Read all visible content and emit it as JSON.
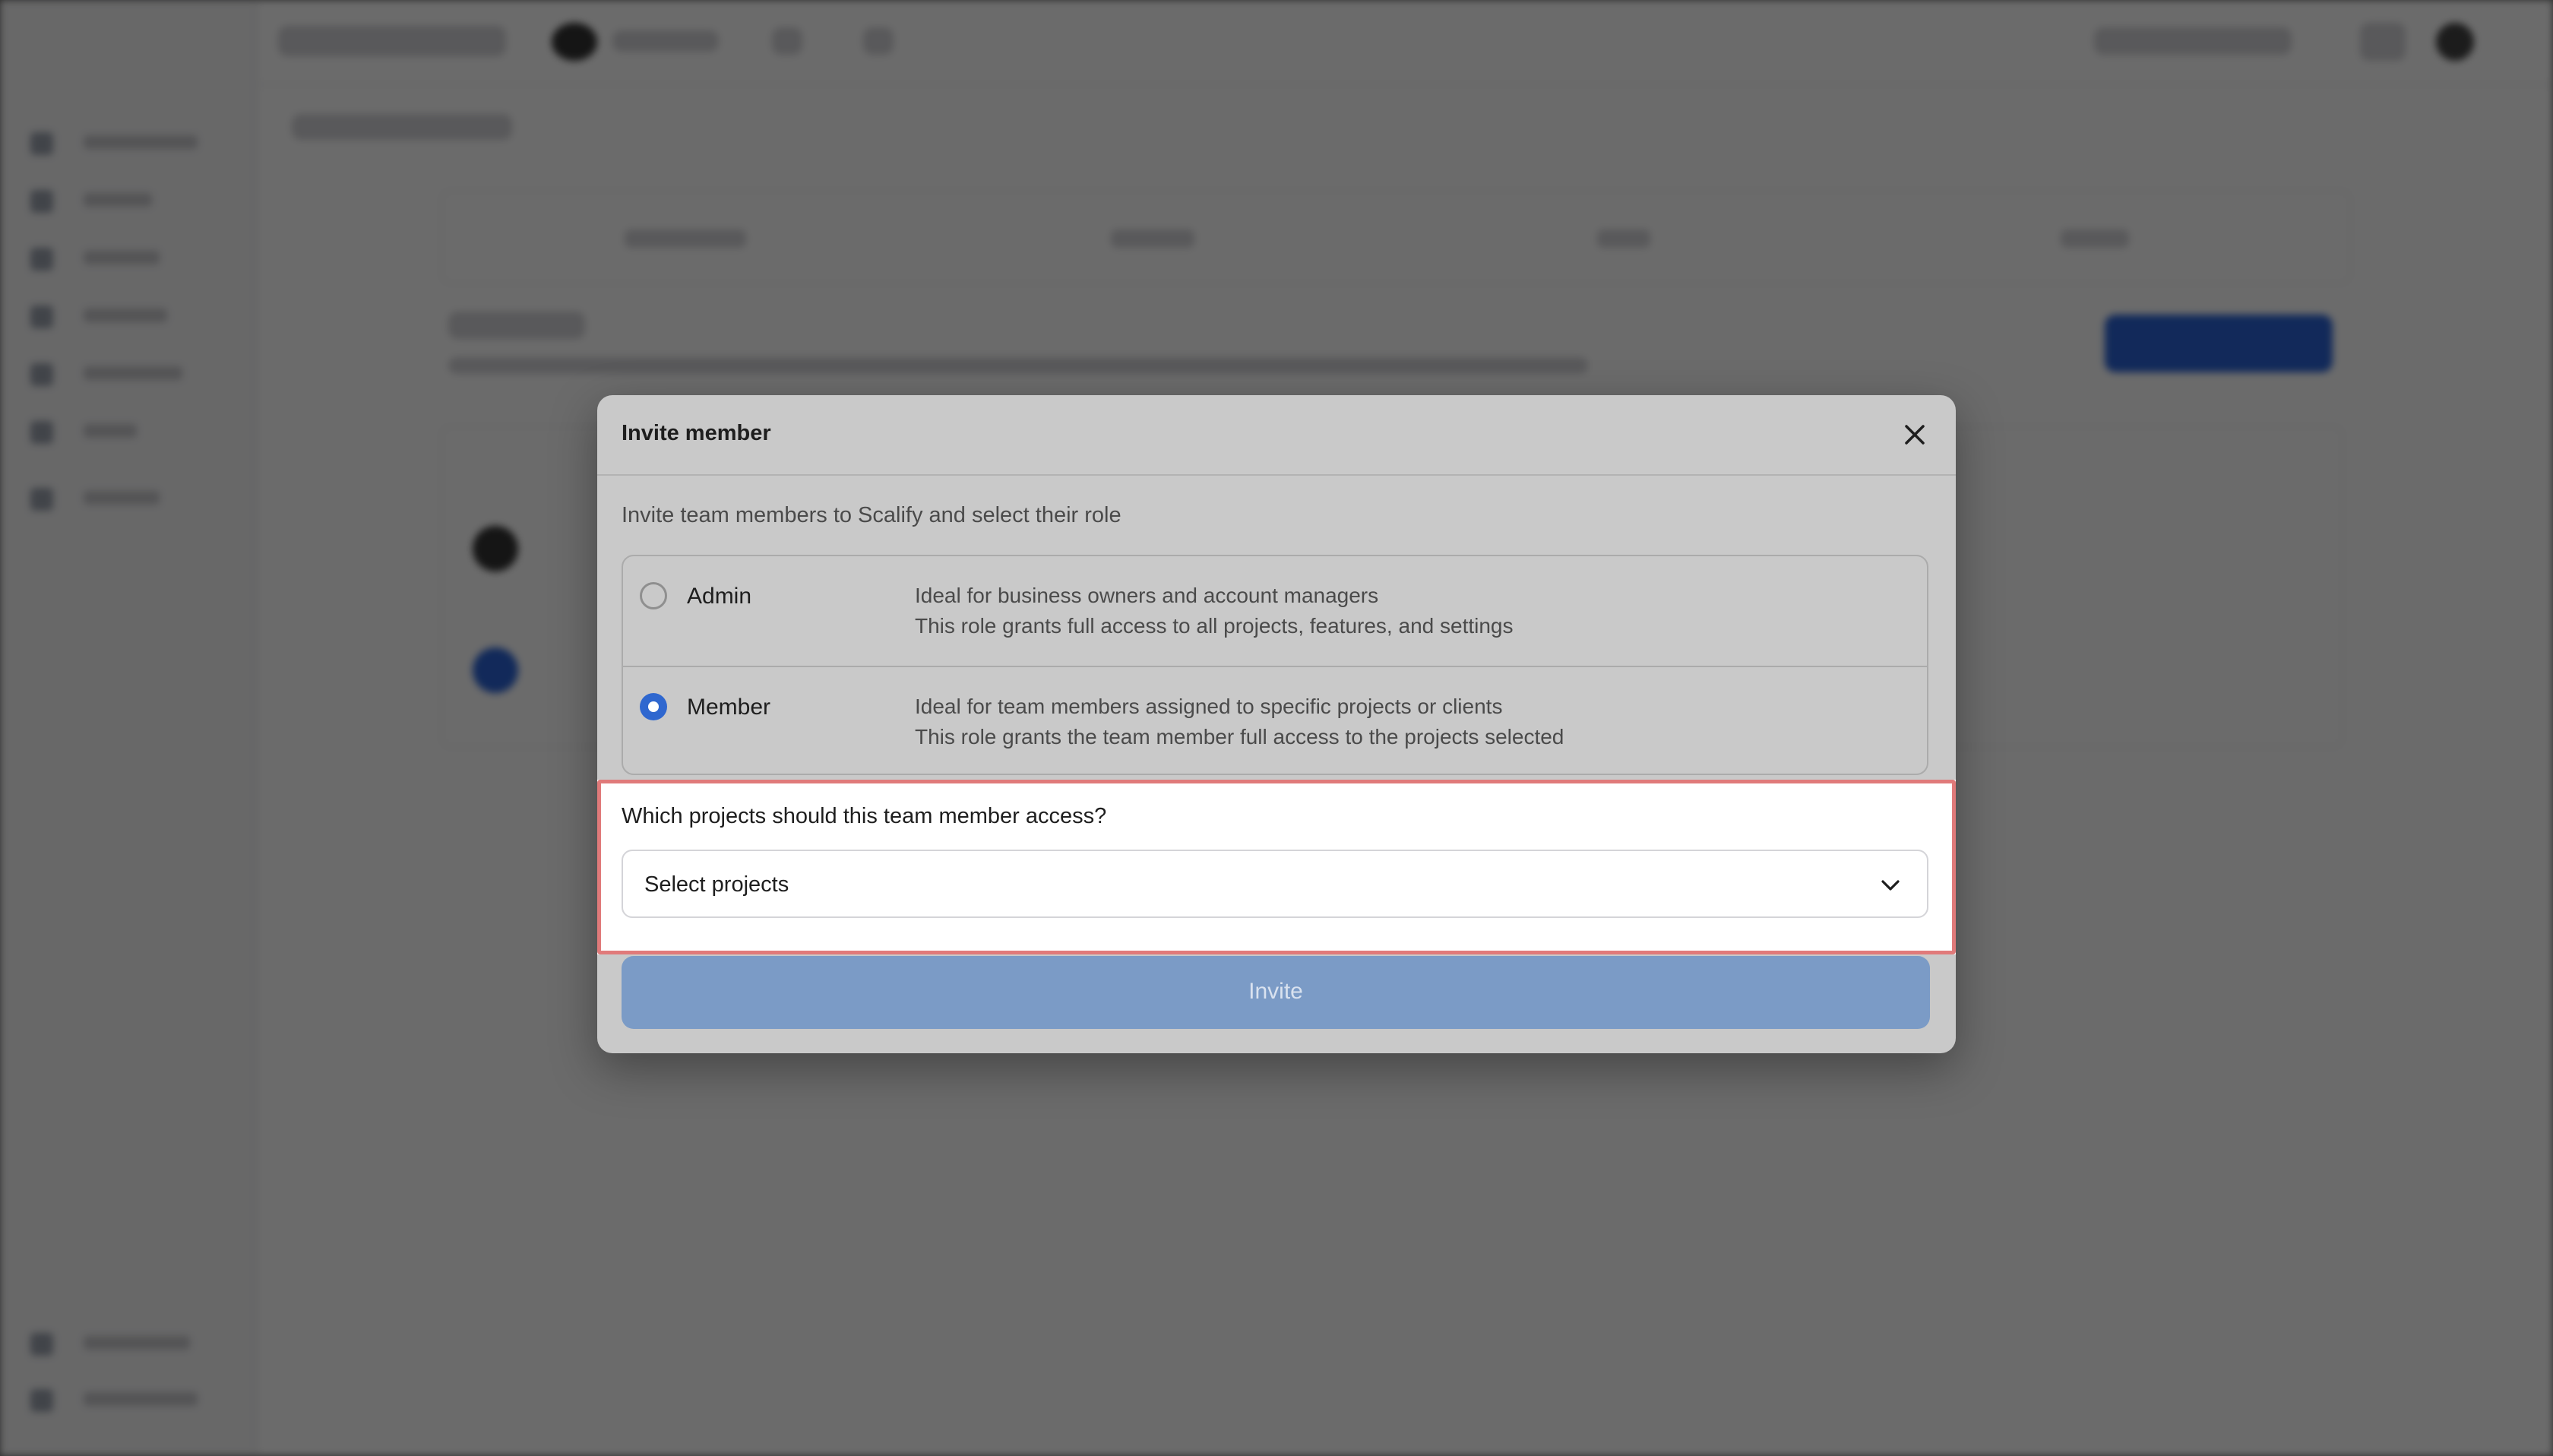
{
  "modal": {
    "title": "Invite member",
    "subtitle": "Invite team members to Scalify and select their role",
    "roles": [
      {
        "name": "Admin",
        "selected": false,
        "description_line1": "Ideal for business owners and account managers",
        "description_line2": "This role grants full access to all projects, features, and settings"
      },
      {
        "name": "Member",
        "selected": true,
        "description_line1": "Ideal for team members assigned to specific projects or clients",
        "description_line2": "This role grants the team member full access to the projects selected"
      }
    ],
    "projects": {
      "question": "Which projects should this team member access?",
      "select_placeholder": "Select projects"
    },
    "invite_label": "Invite"
  },
  "colors": {
    "accent": "#2f67cf",
    "invite_disabled": "#7b9bc6",
    "highlight": "#e07a7a",
    "overlay": "#6b6b6b"
  },
  "icons": {
    "close": "close-icon",
    "dropdown": "chevron-down-icon"
  }
}
